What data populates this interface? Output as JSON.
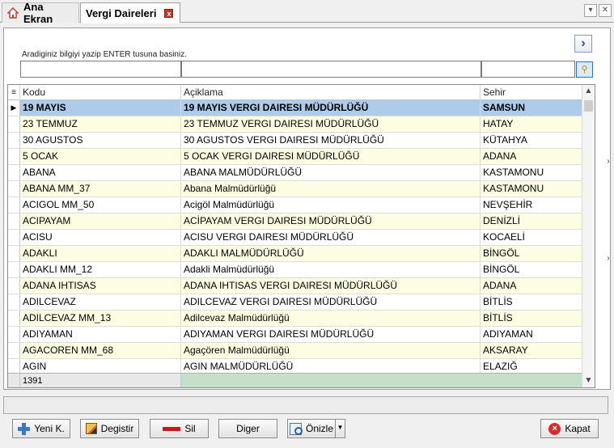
{
  "tabs": {
    "home_label": "Ana Ekran",
    "active_label": "Vergi Daireleri",
    "close_glyph": "x"
  },
  "search": {
    "hint": "Aradiginiz bilgiyi yazip ENTER tusuna basiniz.",
    "code_value": "",
    "desc_value": "",
    "city_value": ""
  },
  "grid": {
    "columns": [
      "Kodu",
      "Açiklama",
      "Sehir"
    ],
    "rows": [
      [
        "19 MAYIS",
        "19 MAYIS VERGI DAIRESI MÜDÜRLÜĞÜ",
        "SAMSUN"
      ],
      [
        "23 TEMMUZ",
        "23 TEMMUZ VERGI DAIRESI MÜDÜRLÜĞÜ",
        "HATAY"
      ],
      [
        "30 AGUSTOS",
        "30 AGUSTOS VERGI DAIRESI MÜDÜRLÜĞÜ",
        "KÜTAHYA"
      ],
      [
        "5 OCAK",
        "5 OCAK VERGI DAIRESI MÜDÜRLÜĞÜ",
        "ADANA"
      ],
      [
        "ABANA",
        "ABANA MALMÜDÜRLÜĞÜ",
        "KASTAMONU"
      ],
      [
        "ABANA MM_37",
        "Abana Malmüdürlüğü",
        "KASTAMONU"
      ],
      [
        "ACIGOL MM_50",
        "Acigöl Malmüdürlüğü",
        "NEVŞEHİR"
      ],
      [
        "ACIPAYAM",
        "ACİPAYAM VERGI DAIRESI MÜDÜRLÜĞÜ",
        "DENİZLİ"
      ],
      [
        "ACISU",
        "ACISU VERGI DAIRESI MÜDÜRLÜĞÜ",
        "KOCAELİ"
      ],
      [
        "ADAKLI",
        "ADAKLI MALMÜDÜRLÜĞÜ",
        "BİNGÖL"
      ],
      [
        "ADAKLI MM_12",
        "Adakli Malmüdürlüğü",
        "BİNGÖL"
      ],
      [
        "ADANA IHTISAS",
        "ADANA IHTISAS VERGI DAIRESI MÜDÜRLÜĞÜ",
        "ADANA"
      ],
      [
        "ADILCEVAZ",
        "ADILCEVAZ VERGI DAIRESI MÜDÜRLÜĞÜ",
        "BİTLİS"
      ],
      [
        "ADILCEVAZ MM_13",
        "Adilcevaz Malmüdürlüğü",
        "BİTLİS"
      ],
      [
        "ADIYAMAN",
        "ADIYAMAN VERGI DAIRESI MÜDÜRLÜĞÜ",
        "ADIYAMAN"
      ],
      [
        "AGACOREN MM_68",
        "Agaçören Malmüdürlüğü",
        "AKSARAY"
      ],
      [
        "AGIN",
        "AGIN MALMÜDÜRLÜĞÜ",
        "ELAZIĞ"
      ]
    ],
    "record_count": "1391",
    "selected_index": 0
  },
  "buttons": {
    "new": "Yeni K.",
    "edit": "Degistir",
    "delete": "Sil",
    "other": "Diger",
    "preview": "Önizle",
    "close": "Kapat"
  },
  "colors": {
    "selected_row": "#aecbea",
    "alt_row": "#fdfde2",
    "footer_green": "#c5dfc9"
  }
}
